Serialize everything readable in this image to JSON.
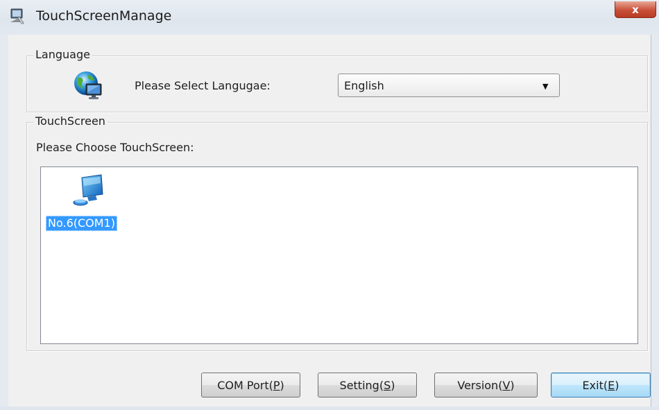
{
  "window": {
    "title": "TouchScreenManage",
    "close_label": "x"
  },
  "language_group": {
    "legend": "Language",
    "prompt": "Please Select Langugae:",
    "selected": "English",
    "icon": "globe-computer-icon"
  },
  "touch_group": {
    "legend": "TouchScreen",
    "prompt": "Please Choose TouchScreen:",
    "devices": [
      {
        "label": "No.6(COM1)",
        "icon": "computer-monitor-icon",
        "selected": true
      }
    ]
  },
  "buttons": {
    "com_port": {
      "text": "COM Port(",
      "key": "P",
      "close": ")"
    },
    "setting": {
      "text": "Setting(",
      "key": "S",
      "close": ")"
    },
    "version": {
      "text": "Version(",
      "key": "V",
      "close": ")"
    },
    "exit": {
      "text": "Exit(",
      "key": "E",
      "close": ")"
    }
  },
  "colors": {
    "selection": "#3399ff",
    "close_button": "#c9503a",
    "default_button_border": "#3c7fb1"
  }
}
